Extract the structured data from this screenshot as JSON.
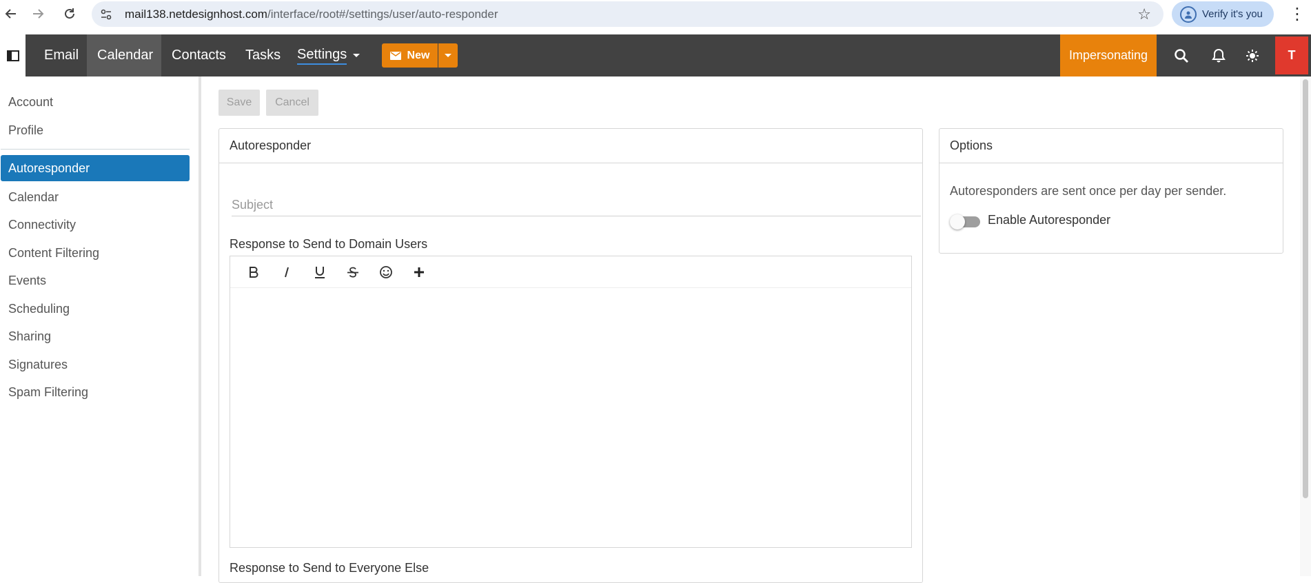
{
  "browser": {
    "url_host": "mail138.netdesignhost.com",
    "url_path": "/interface/root#/settings/user/auto-responder",
    "verify_label": "Verify it's you"
  },
  "appnav": {
    "items": [
      {
        "label": "Email"
      },
      {
        "label": "Calendar",
        "active": true
      },
      {
        "label": "Contacts"
      },
      {
        "label": "Tasks"
      },
      {
        "label": "Settings"
      }
    ],
    "new_label": "New",
    "impersonating_label": "Impersonating",
    "avatar_initial": "T",
    "accent_color": "#e8820c"
  },
  "sidebar": {
    "items": [
      {
        "label": "Account"
      },
      {
        "label": "Profile"
      },
      {
        "label": "Autoresponder",
        "active": true
      },
      {
        "label": "Calendar"
      },
      {
        "label": "Connectivity"
      },
      {
        "label": "Content Filtering"
      },
      {
        "label": "Events"
      },
      {
        "label": "Scheduling"
      },
      {
        "label": "Sharing"
      },
      {
        "label": "Signatures"
      },
      {
        "label": "Spam Filtering"
      }
    ],
    "active_color": "#1a78b9"
  },
  "actions": {
    "save_label": "Save",
    "cancel_label": "Cancel"
  },
  "autoresponder": {
    "title": "Autoresponder",
    "subject_placeholder": "Subject",
    "domain_users_label": "Response to Send to Domain Users",
    "everyone_else_label": "Response to Send to Everyone Else",
    "toolbar": [
      "bold-icon",
      "italic-icon",
      "underline-icon",
      "strikethrough-icon",
      "emoji-icon",
      "plus-icon"
    ]
  },
  "options": {
    "title": "Options",
    "info_text": "Autoresponders are sent once per day per sender.",
    "enable_label": "Enable Autoresponder",
    "enabled": false
  }
}
